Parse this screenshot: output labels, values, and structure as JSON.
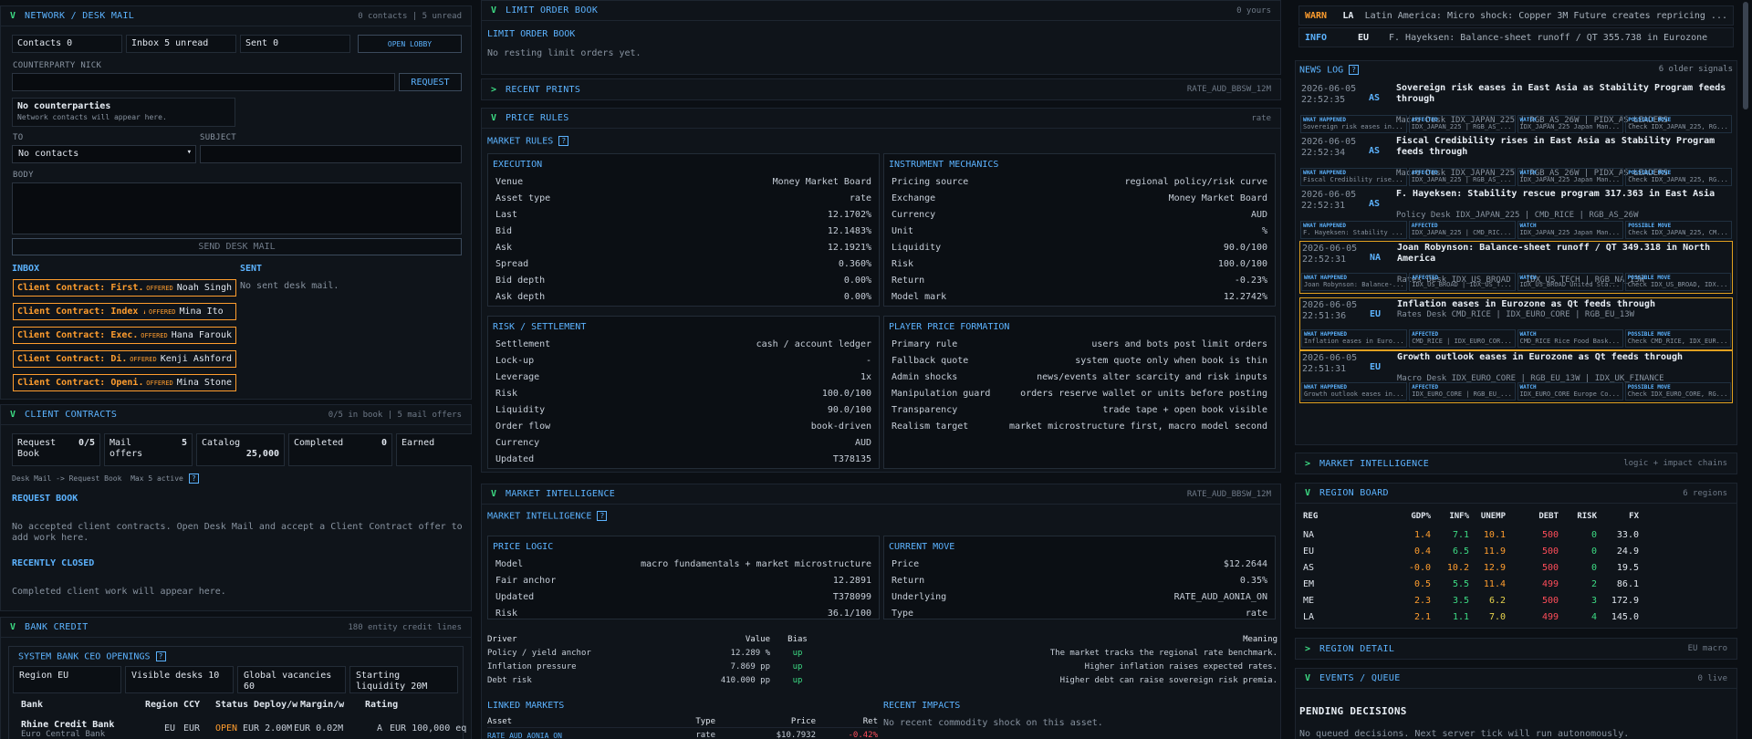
{
  "network": {
    "title": "NETWORK / DESK MAIL",
    "status": "0 contacts | 5 unread",
    "contacts": "Contacts 0",
    "inbox": "Inbox 5 unread",
    "sent": "Sent 0",
    "open_lobby": "OPEN LOBBY",
    "counterparty_label": "COUNTERPARTY NICK",
    "request_btn": "REQUEST",
    "no_cp_title": "No counterparties",
    "no_cp_sub": "Network contacts will appear here.",
    "to_label": "TO",
    "subject_label": "SUBJECT",
    "to_value": "No contacts",
    "body_label": "BODY",
    "send_btn": "SEND DESK MAIL",
    "inbox_label": "INBOX",
    "sent_label": "SENT",
    "no_sent": "No sent desk mail.",
    "offered": "OFFERED",
    "inbox_items": [
      {
        "subject": "Client Contract: First...",
        "from": "Noah Singh"
      },
      {
        "subject": "Client Contract: Index A...",
        "from": "Mina Ito"
      },
      {
        "subject": "Client Contract: Exec...",
        "from": "Hana Farouk"
      },
      {
        "subject": "Client Contract: Di...",
        "from": "Kenji Ashford"
      },
      {
        "subject": "Client Contract: Openi...",
        "from": "Mina Stone"
      }
    ]
  },
  "client": {
    "title": "CLIENT CONTRACTS",
    "status": "0/5 in book | 5 mail offers",
    "stats": [
      {
        "label": "Request Book",
        "value": "0/5"
      },
      {
        "label": "Mail offers",
        "value": "5"
      },
      {
        "label": "Catalog",
        "value": "25,000"
      },
      {
        "label": "Completed",
        "value": "0"
      },
      {
        "label": "Earned",
        "value": "0"
      }
    ],
    "flow": "Desk Mail -> Request Book",
    "max": "Max 5 active",
    "request_book": "REQUEST BOOK",
    "request_empty": "No accepted client contracts. Open Desk Mail and accept a Client Contract offer to add work here.",
    "recently_closed": "RECENTLY CLOSED",
    "closed_empty": "Completed client work will appear here."
  },
  "bank": {
    "title": "BANK CREDIT",
    "status": "180 entity credit lines",
    "openings": "SYSTEM BANK CEO OPENINGS",
    "stats": [
      "Region EU",
      "Visible desks 10",
      "Global vacancies 60",
      "Starting liquidity 20M"
    ],
    "cols": [
      "Bank",
      "Region",
      "CCY",
      "Status",
      "Deploy/w",
      "Margin/w",
      "Rating"
    ],
    "row": {
      "bank": "Rhine Credit Bank",
      "sub": "Euro Central Bank",
      "region": "EU",
      "ccy": "EUR",
      "status": "OPEN",
      "deploy": "EUR 2.00M",
      "margin": "EUR 0.02M",
      "rating": "A",
      "extra": "EUR 100,000 eq"
    }
  },
  "limit": {
    "title": "LIMIT ORDER BOOK",
    "status": "0 yours",
    "heading": "LIMIT ORDER BOOK",
    "empty": "No resting limit orders yet."
  },
  "prints": {
    "title": "RECENT PRINTS",
    "status": "RATE_AUD_BBSW_12M"
  },
  "rules": {
    "title": "PRICE RULES",
    "status": "rate",
    "heading": "MARKET RULES",
    "execution": {
      "title": "EXECUTION",
      "rows": [
        [
          "Venue",
          "Money Market Board"
        ],
        [
          "Asset type",
          "rate"
        ],
        [
          "Last",
          "12.1702%"
        ],
        [
          "Bid",
          "12.1483%"
        ],
        [
          "Ask",
          "12.1921%"
        ],
        [
          "Spread",
          "0.360%"
        ],
        [
          "Bid depth",
          "0.00%"
        ],
        [
          "Ask depth",
          "0.00%"
        ]
      ]
    },
    "instrument": {
      "title": "INSTRUMENT MECHANICS",
      "rows": [
        [
          "Pricing source",
          "regional policy/risk curve"
        ],
        [
          "Exchange",
          "Money Market Board"
        ],
        [
          "Currency",
          "AUD"
        ],
        [
          "Unit",
          "%"
        ],
        [
          "Liquidity",
          "90.0/100"
        ],
        [
          "Risk",
          "100.0/100"
        ],
        [
          "Return",
          "-0.23%"
        ],
        [
          "Model mark",
          "12.2742%"
        ]
      ]
    },
    "risk": {
      "title": "RISK / SETTLEMENT",
      "rows": [
        [
          "Settlement",
          "cash / account ledger"
        ],
        [
          "Lock-up",
          "-"
        ],
        [
          "Leverage",
          "1x"
        ],
        [
          "Risk",
          "100.0/100"
        ],
        [
          "Liquidity",
          "90.0/100"
        ],
        [
          "Order flow",
          "book-driven"
        ],
        [
          "Currency",
          "AUD"
        ],
        [
          "Updated",
          "T378135"
        ]
      ]
    },
    "player": {
      "title": "PLAYER PRICE FORMATION",
      "rows": [
        [
          "Primary rule",
          "users and bots post limit orders"
        ],
        [
          "Fallback quote",
          "system quote only when book is thin"
        ],
        [
          "Admin shocks",
          "news/events alter scarcity and risk inputs"
        ],
        [
          "Manipulation guard",
          "orders reserve wallet or units before posting"
        ],
        [
          "Transparency",
          "trade tape + open book visible"
        ],
        [
          "Realism target",
          "market microstructure first, macro model second"
        ]
      ]
    }
  },
  "intel": {
    "title": "MARKET INTELLIGENCE",
    "status": "RATE_AUD_BBSW_12M",
    "heading": "MARKET INTELLIGENCE",
    "logic": {
      "title": "PRICE LOGIC",
      "rows": [
        [
          "Model",
          "macro fundamentals + market microstructure"
        ],
        [
          "Fair anchor",
          "12.2891"
        ],
        [
          "Updated",
          "T378099"
        ],
        [
          "Risk",
          "36.1/100"
        ]
      ]
    },
    "move": {
      "title": "CURRENT MOVE",
      "rows": [
        [
          "Price",
          "$12.2644"
        ],
        [
          "Return",
          "0.35%"
        ],
        [
          "Underlying",
          "RATE_AUD_AONIA_ON"
        ],
        [
          "Type",
          "rate"
        ]
      ]
    },
    "driver_cols": [
      "Driver",
      "Value",
      "Bias",
      "Meaning"
    ],
    "drivers": [
      {
        "d": "Policy / yield anchor",
        "v": "12.289 %",
        "b": "up",
        "m": "The market tracks the regional rate benchmark."
      },
      {
        "d": "Inflation pressure",
        "v": "7.869 pp",
        "b": "up",
        "m": "Higher inflation raises expected rates."
      },
      {
        "d": "Debt risk",
        "v": "410.000 pp",
        "b": "up",
        "m": "Higher debt can raise sovereign risk premia."
      }
    ],
    "linked": "LINKED MARKETS",
    "linked_cols": [
      "Asset",
      "Type",
      "Price",
      "Ret"
    ],
    "linked_row": {
      "asset": "RATE_AUD_AONIA_ON",
      "type": "rate",
      "price": "$10.7932",
      "ret": "-0.42%"
    },
    "impacts": "RECENT IMPACTS",
    "impacts_empty": "No recent commodity shock on this asset."
  },
  "alerts": [
    {
      "level": "WARN",
      "region": "LA",
      "text": "Latin America: Micro shock: Copper 3M Future creates repricing ..."
    },
    {
      "level": "INFO",
      "region": "EU",
      "text": "F. Hayeksen: Balance-sheet runoff / QT 355.738 in Eurozone"
    }
  ],
  "newslog": {
    "title": "NEWS LOG",
    "status": "6 older signals",
    "cell_heads": [
      "WHAT HAPPENED",
      "AFFECTED",
      "WATCH",
      "POSSIBLE MOVE"
    ],
    "items": [
      {
        "ts": "2026-06-05 22:52:35",
        "region": "AS",
        "title": "Sovereign risk eases in East Asia as Stability Program feeds through",
        "sub": "Macro Desk IDX_JAPAN_225 | RGB_AS_26W | PIDX_AS_LEADERS",
        "cells": [
          "Sovereign risk eases in...",
          "IDX_JAPAN_225 | RGB_AS_...",
          "IDX_JAPAN_225 Japan Man...",
          "Check IDX_JAPAN_225, RG..."
        ],
        "hl": false
      },
      {
        "ts": "2026-06-05 22:52:34",
        "region": "AS",
        "title": "Fiscal Credibility rises in East Asia as Stability Program feeds through",
        "sub": "Macro Desk IDX_JAPAN_225 | RGB_AS_26W | PIDX_AS_LEADERS",
        "cells": [
          "Fiscal Credibility rise...",
          "IDX_JAPAN_225 | RGB_AS_...",
          "IDX_JAPAN_225 Japan Man...",
          "Check IDX_JAPAN_225, RG..."
        ],
        "hl": false
      },
      {
        "ts": "2026-06-05 22:52:31",
        "region": "AS",
        "title": "F. Hayeksen: Stability rescue program 317.363 in East Asia",
        "sub": "Policy Desk IDX_JAPAN_225 | CMD_RICE | RGB_AS_26W",
        "cells": [
          "F. Hayeksen: Stability ...",
          "IDX_JAPAN_225 | CMD_RIC...",
          "IDX_JAPAN_225 Japan Man...",
          "Check IDX_JAPAN_225, CM..."
        ],
        "hl": false
      },
      {
        "ts": "2026-06-05 22:52:31",
        "region": "NA",
        "title": "Joan Robynson: Balance-sheet runoff / QT 349.318 in North America",
        "sub": "Rates Desk IDX_US_BROAD | IDX_US_TECH | RGB_NA_13W",
        "cells": [
          "Joan Robynson: Balance-...",
          "IDX_US_BROAD | IDX_US_T...",
          "IDX_US_BROAD United Sta...",
          "Check IDX_US_BROAD, IDX..."
        ],
        "hl": true
      },
      {
        "ts": "2026-06-05 22:51:36",
        "region": "EU",
        "title": "Inflation eases in Eurozone as Qt feeds through",
        "sub": "Rates Desk CMD_RICE | IDX_EURO_CORE | RGB_EU_13W",
        "cells": [
          "Inflation eases in Euro...",
          "CMD_RICE | IDX_EURO_COR...",
          "CMD_RICE Rice Food Bask...",
          "Check CMD_RICE, IDX_EUR..."
        ],
        "hl": true
      },
      {
        "ts": "2026-06-05 22:51:31",
        "region": "EU",
        "title": "Growth outlook eases in Eurozone as Qt feeds through",
        "sub": "Macro Desk IDX_EURO_CORE | RGB_EU_13W | IDX_UK_FINANCE",
        "cells": [
          "Growth outlook eases in...",
          "IDX_EURO_CORE | RGB_EU_...",
          "IDX_EURO_CORE Europe Co...",
          "Check IDX_EURO_CORE, RG..."
        ],
        "hl": true
      }
    ]
  },
  "intel_collapsed": {
    "title": "MARKET INTELLIGENCE",
    "status": "logic + impact chains"
  },
  "region_board": {
    "title": "REGION BOARD",
    "status": "6 regions",
    "cols": [
      "REG",
      "GDP%",
      "INF%",
      "UNEMP",
      "DEBT",
      "RISK",
      "FX"
    ],
    "rows": [
      {
        "reg": "NA",
        "gdp": "1.4",
        "inf": "7.1",
        "unemp": "10.1",
        "debt": "500",
        "risk": "0",
        "fx": "33.0"
      },
      {
        "reg": "EU",
        "gdp": "0.4",
        "inf": "6.5",
        "unemp": "11.9",
        "debt": "500",
        "risk": "0",
        "fx": "24.9"
      },
      {
        "reg": "AS",
        "gdp": "-0.0",
        "inf": "10.2",
        "unemp": "12.9",
        "debt": "500",
        "risk": "0",
        "fx": "19.5"
      },
      {
        "reg": "EM",
        "gdp": "0.5",
        "inf": "5.5",
        "unemp": "11.4",
        "debt": "499",
        "risk": "2",
        "fx": "86.1"
      },
      {
        "reg": "ME",
        "gdp": "2.3",
        "inf": "3.5",
        "unemp": "6.2",
        "debt": "500",
        "risk": "3",
        "fx": "172.9"
      },
      {
        "reg": "LA",
        "gdp": "2.1",
        "inf": "1.1",
        "unemp": "7.0",
        "debt": "499",
        "risk": "4",
        "fx": "145.0"
      }
    ]
  },
  "region_detail": {
    "title": "REGION DETAIL",
    "status": "EU macro"
  },
  "events": {
    "title": "EVENTS / QUEUE",
    "status": "0 live",
    "pending": "PENDING DECISIONS",
    "empty": "No queued decisions. Next server tick will run autonomously."
  },
  "colors": {
    "accent": "#5cb3ff",
    "green": "#3ddc84",
    "orange": "#ff9d2e",
    "red": "#ff4d5a",
    "yellow": "#e8d44d"
  }
}
